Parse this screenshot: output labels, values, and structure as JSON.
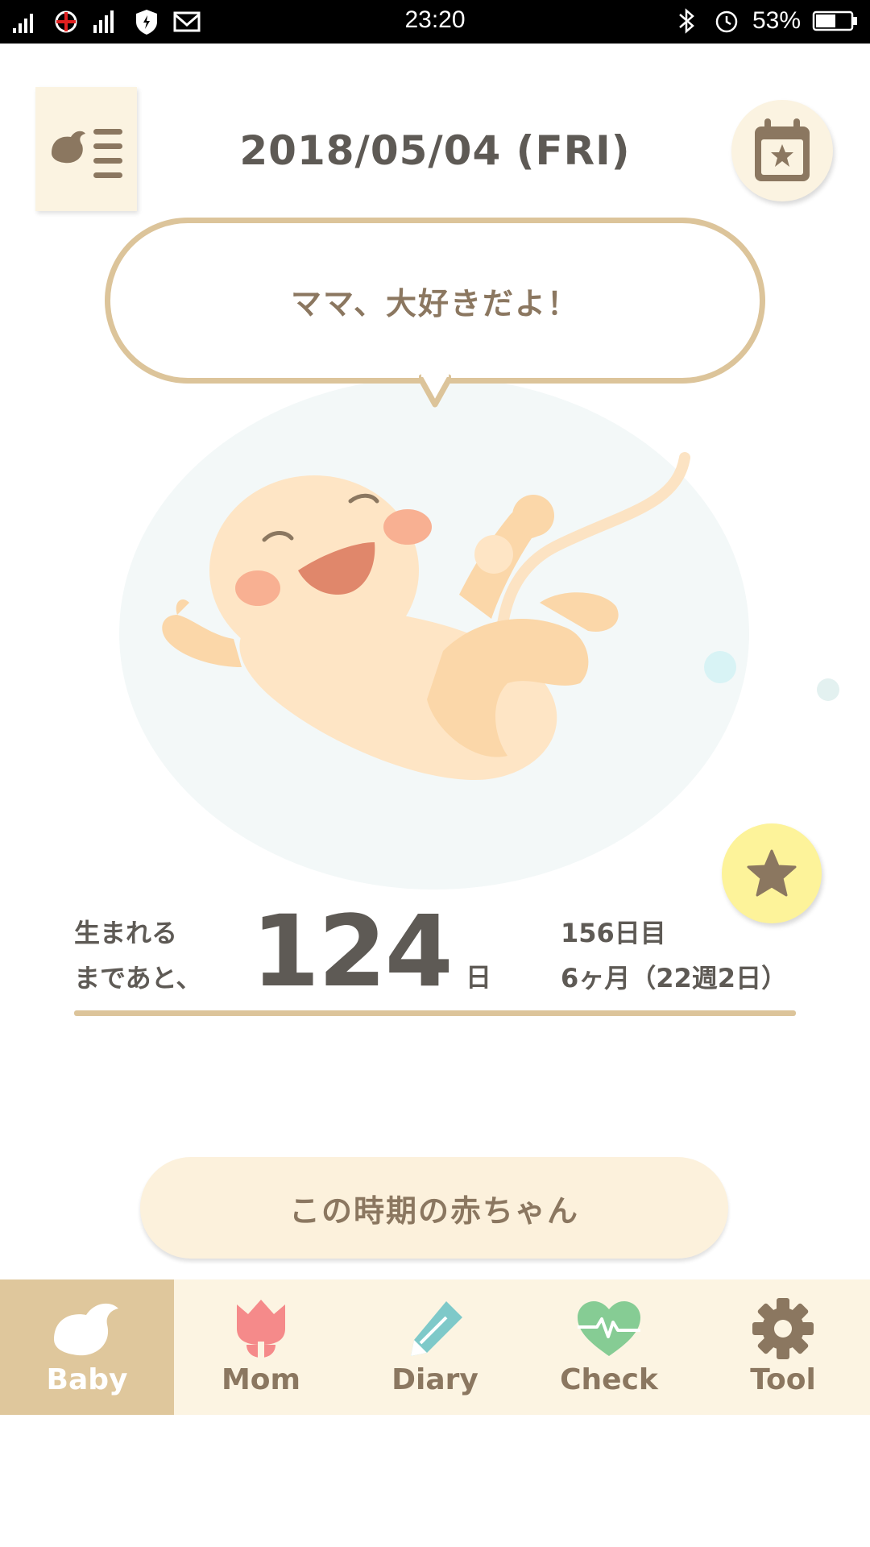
{
  "status_bar": {
    "time": "23:20",
    "battery": "53%",
    "icons": [
      "signal-icon",
      "antenna-icon",
      "network-signal-icon",
      "shield-icon",
      "mail-icon",
      "bluetooth-icon",
      "alarm-icon",
      "battery-icon"
    ]
  },
  "header": {
    "date": "2018/05/04 (FRI)",
    "menu_icon": "bird-list-icon",
    "calendar_icon": "calendar-star-icon"
  },
  "bubble": {
    "message": "ママ、大好きだよ！"
  },
  "countdown": {
    "label_line1": "生まれる",
    "label_line2": "まであと、",
    "days_left": "124",
    "unit": "日",
    "day_count": "156日目",
    "month_week": "6ヶ月（22週2日）"
  },
  "period_button": {
    "label": "この時期の赤ちゃん"
  },
  "bottom_nav": {
    "items": [
      {
        "label": "Baby",
        "icon": "bird-icon",
        "active": true
      },
      {
        "label": "Mom",
        "icon": "tulip-icon",
        "active": false
      },
      {
        "label": "Diary",
        "icon": "pencil-icon",
        "active": false
      },
      {
        "label": "Check",
        "icon": "heart-pulse-icon",
        "active": false
      },
      {
        "label": "Tool",
        "icon": "gear-icon",
        "active": false
      }
    ]
  },
  "colors": {
    "accent_gold": "#dcc49a",
    "text_brown": "#8b7760",
    "text_dark": "#5e5a55",
    "cream": "#fcf4e2",
    "star_yellow": "#fdf39a"
  }
}
